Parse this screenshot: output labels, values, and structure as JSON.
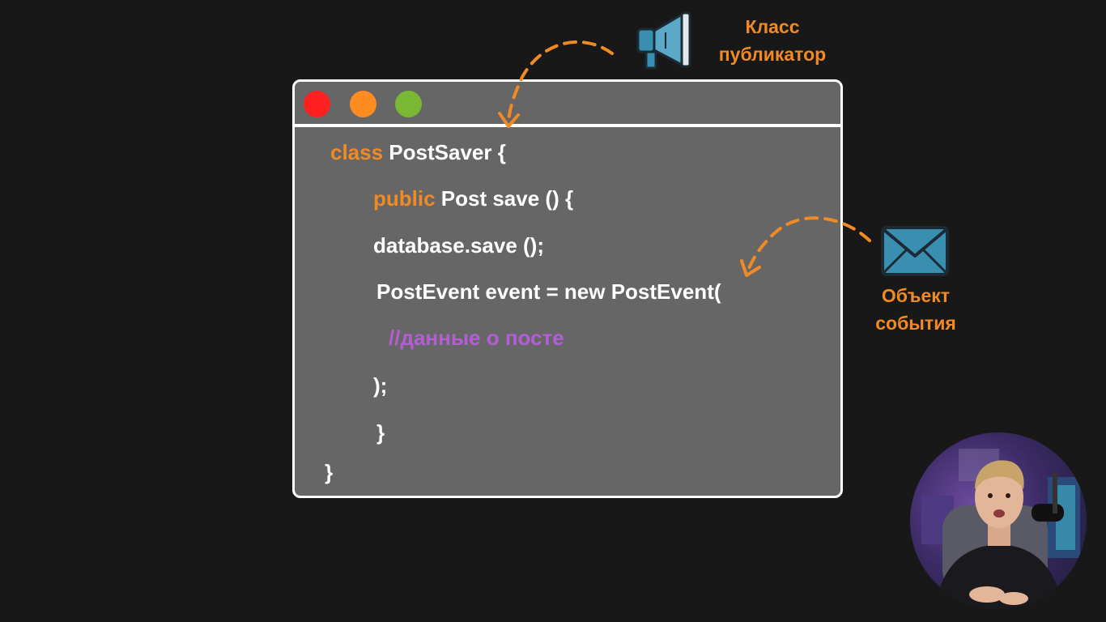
{
  "code": {
    "lines": [
      {
        "keyword": "class",
        "text": " PostSaver {"
      },
      {
        "keyword": "public",
        "text": " Post save () {"
      },
      {
        "keyword": "",
        "text": "database.save ();"
      },
      {
        "keyword": "",
        "text": "PostEvent event = new PostEvent("
      },
      {
        "comment": "//данные о посте"
      },
      {
        "keyword": "",
        "text": ");"
      },
      {
        "keyword": "",
        "text": "}"
      },
      {
        "keyword": "",
        "text": "}"
      }
    ]
  },
  "annotations": {
    "publisher_line1": "Класс",
    "publisher_line2": "публикатор",
    "event_line1": "Объект",
    "event_line2": "события"
  },
  "icons": {
    "publisher": "megaphone-icon",
    "event": "envelope-icon"
  },
  "colors": {
    "background": "#181818",
    "window": "#666666",
    "keyword": "#f08a24",
    "comment": "#b45ed6",
    "dot_red": "#ff2020",
    "dot_orange": "#ff8c20",
    "dot_green": "#7ab833"
  }
}
